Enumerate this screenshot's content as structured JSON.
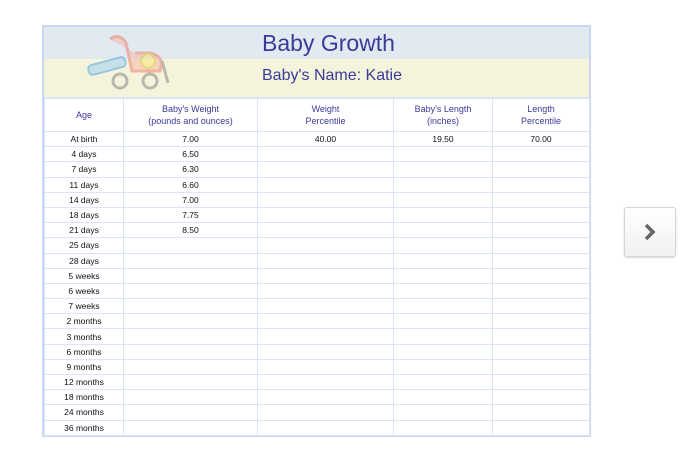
{
  "title": "Baby Growth",
  "name_line": "Baby's Name: Katie",
  "headers": [
    [
      "Age",
      ""
    ],
    [
      "Baby's Weight",
      "(pounds and ounces)"
    ],
    [
      "Weight",
      "Percentile"
    ],
    [
      "Baby's Length",
      "(inches)"
    ],
    [
      "Length",
      "Percentile"
    ]
  ],
  "rows": [
    [
      "At birth",
      "7.00",
      "40.00",
      "19.50",
      "70.00"
    ],
    [
      "4 days",
      "6.50",
      "",
      "",
      ""
    ],
    [
      "7 days",
      "6.30",
      "",
      "",
      ""
    ],
    [
      "11 days",
      "6.60",
      "",
      "",
      ""
    ],
    [
      "14 days",
      "7.00",
      "",
      "",
      ""
    ],
    [
      "18 days",
      "7.75",
      "",
      "",
      ""
    ],
    [
      "21 days",
      "8.50",
      "",
      "",
      ""
    ],
    [
      "25 days",
      "",
      "",
      "",
      ""
    ],
    [
      "28 days",
      "",
      "",
      "",
      ""
    ],
    [
      "5 weeks",
      "",
      "",
      "",
      ""
    ],
    [
      "6 weeks",
      "",
      "",
      "",
      ""
    ],
    [
      "7 weeks",
      "",
      "",
      "",
      ""
    ],
    [
      "2 months",
      "",
      "",
      "",
      ""
    ],
    [
      "3 months",
      "",
      "",
      "",
      ""
    ],
    [
      "6 months",
      "",
      "",
      "",
      ""
    ],
    [
      "9 months",
      "",
      "",
      "",
      ""
    ],
    [
      "12 months",
      "",
      "",
      "",
      ""
    ],
    [
      "18 months",
      "",
      "",
      "",
      ""
    ],
    [
      "24 months",
      "",
      "",
      "",
      ""
    ],
    [
      "36 months",
      "",
      "",
      "",
      ""
    ]
  ],
  "next_icon": "chevron-right-icon"
}
